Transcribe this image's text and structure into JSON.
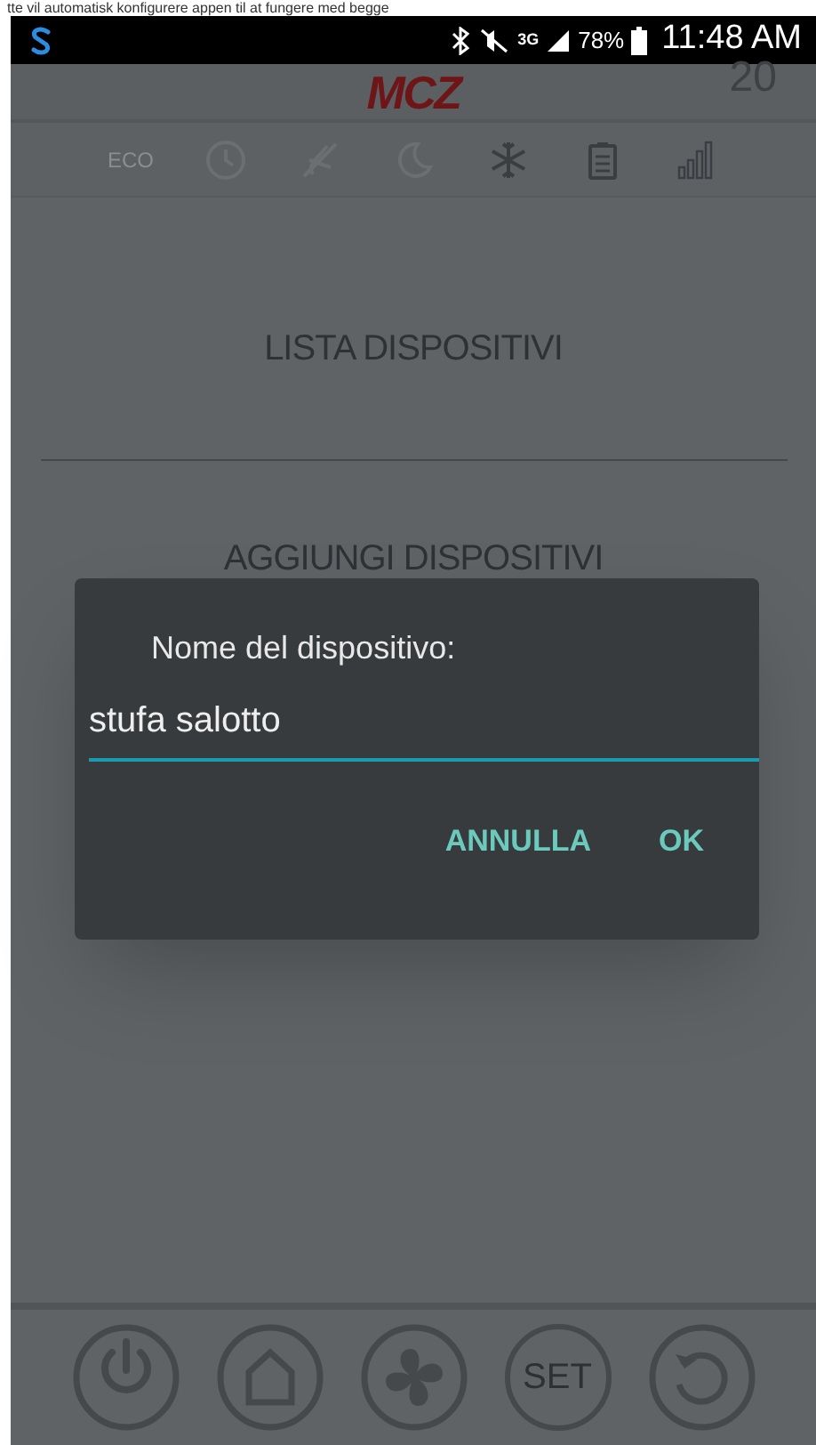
{
  "caption": "tte vil automatisk konfigurere appen til at fungere med begge",
  "status_bar": {
    "battery": "78%",
    "time": "11:48 AM",
    "network": "3G"
  },
  "header": {
    "logo": "MCZ",
    "value": "20"
  },
  "mode_icons": [
    {
      "kind": "eco",
      "label": "ECO",
      "active": false
    },
    {
      "kind": "clock",
      "active": false
    },
    {
      "kind": "fan-off",
      "active": false
    },
    {
      "kind": "moon",
      "active": false
    },
    {
      "kind": "snowflake",
      "active": true
    },
    {
      "kind": "clipboard",
      "active": true
    },
    {
      "kind": "bars",
      "active": true
    }
  ],
  "menu": [
    "LISTA DISPOSITIVI",
    "AGGIUNGI DISPOSITIVI"
  ],
  "dialog": {
    "title": "Nome del dispositivo:",
    "value": "stufa salotto",
    "buttons": [
      "ANNULLA",
      "OK"
    ]
  },
  "bottom_buttons": [
    {
      "kind": "power"
    },
    {
      "kind": "home"
    },
    {
      "kind": "fan"
    },
    {
      "kind": "set",
      "label": "SET"
    },
    {
      "kind": "restore"
    }
  ]
}
